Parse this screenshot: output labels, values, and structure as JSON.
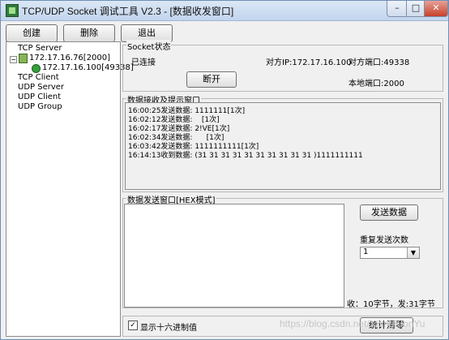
{
  "window": {
    "title": "TCP/UDP Socket 调试工具 V2.3 - [数据收发窗口]",
    "min": "–",
    "max": "□",
    "close": "✕"
  },
  "toolbar": {
    "create": "创建",
    "delete": "删除",
    "exit": "退出"
  },
  "tree": {
    "tcp_server": "TCP Server",
    "server_node": "172.17.16.76[2000]",
    "client_node": "172.17.16.100[49338]",
    "tcp_client": "TCP Client",
    "udp_server": "UDP Server",
    "udp_client": "UDP Client",
    "udp_group": "UDP Group"
  },
  "socket_status": {
    "title": "Socket状态",
    "state": "已连接",
    "remote_ip": "对方IP:172.17.16.100",
    "remote_port": "对方端口:49338",
    "local_port": "本地端口:2000",
    "disconnect": "断开"
  },
  "receive": {
    "title": "数据接收及提示窗口",
    "lines": [
      "16:00:25发送数据: 1111111[1次]",
      "16:02:12发送数据:    [1次]",
      "16:02:17发送数据: 2!VE[1次]",
      "16:02:34发送数据:      [1次]",
      "16:03:42发送数据: 1111111111[1次]",
      "16:14:13收到数据: (31 31 31 31 31 31 31 31 31 31 )1111111111"
    ]
  },
  "send": {
    "title": "数据发送窗口[HEX模式]",
    "send_button": "发送数据",
    "repeat_label": "重复发送次数",
    "repeat_value": "1",
    "stats": "收：10字节，发:31字节"
  },
  "footer": {
    "hex_display": "显示十六进制值",
    "clear_stats": "统计清零",
    "checked_mark": "✓"
  },
  "watermark": "https://blog.csdn.net/XiongXionYu"
}
